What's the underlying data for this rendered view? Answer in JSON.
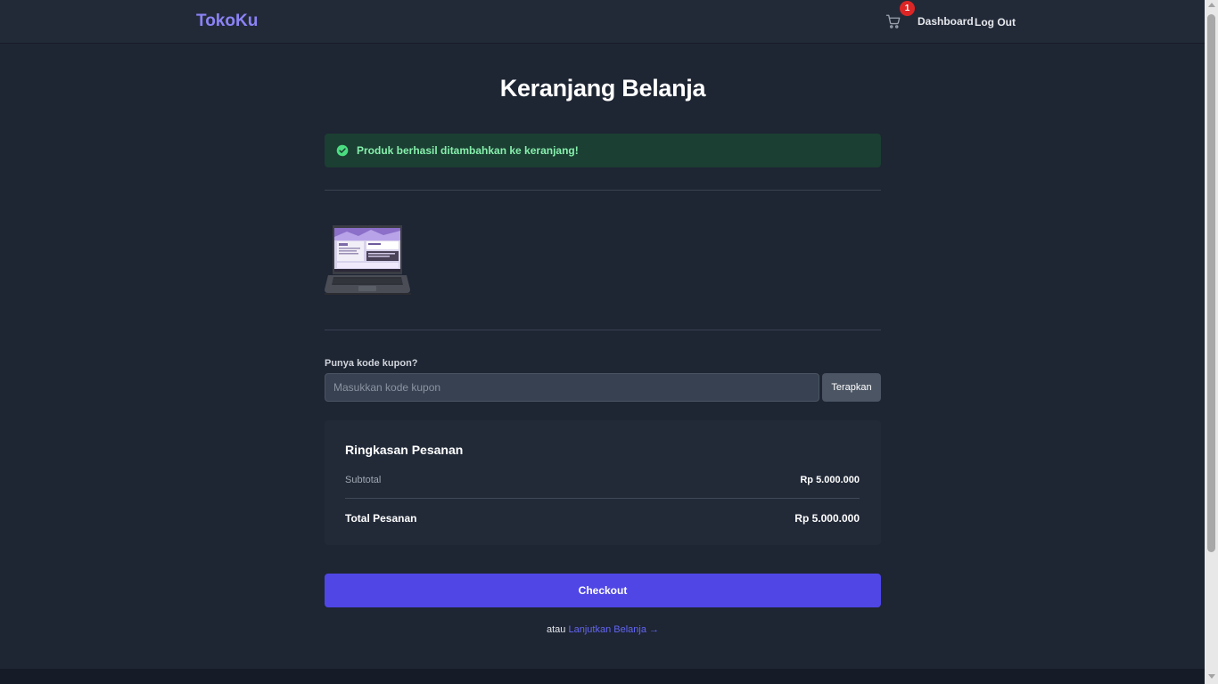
{
  "header": {
    "brand": "TokoKu",
    "cart_count": "1",
    "nav": {
      "dashboard": "Dashboard",
      "logout": "Log Out"
    }
  },
  "page": {
    "title": "Keranjang Belanja"
  },
  "alert": {
    "message": "Produk berhasil ditambahkan ke keranjang!",
    "icon": "check-circle-icon",
    "color": "#86efac"
  },
  "product": {
    "image": "laptop-image"
  },
  "coupon": {
    "label": "Punya kode kupon?",
    "placeholder": "Masukkan kode kupon",
    "value": "",
    "apply_label": "Terapkan"
  },
  "summary": {
    "title": "Ringkasan Pesanan",
    "subtotal_label": "Subtotal",
    "subtotal_value": "Rp 5.000.000",
    "total_label": "Total Pesanan",
    "total_value": "Rp 5.000.000"
  },
  "checkout": {
    "label": "Checkout",
    "color": "#4f46e5"
  },
  "continue": {
    "prefix": "atau",
    "link": "Lanjutkan Belanja →"
  }
}
